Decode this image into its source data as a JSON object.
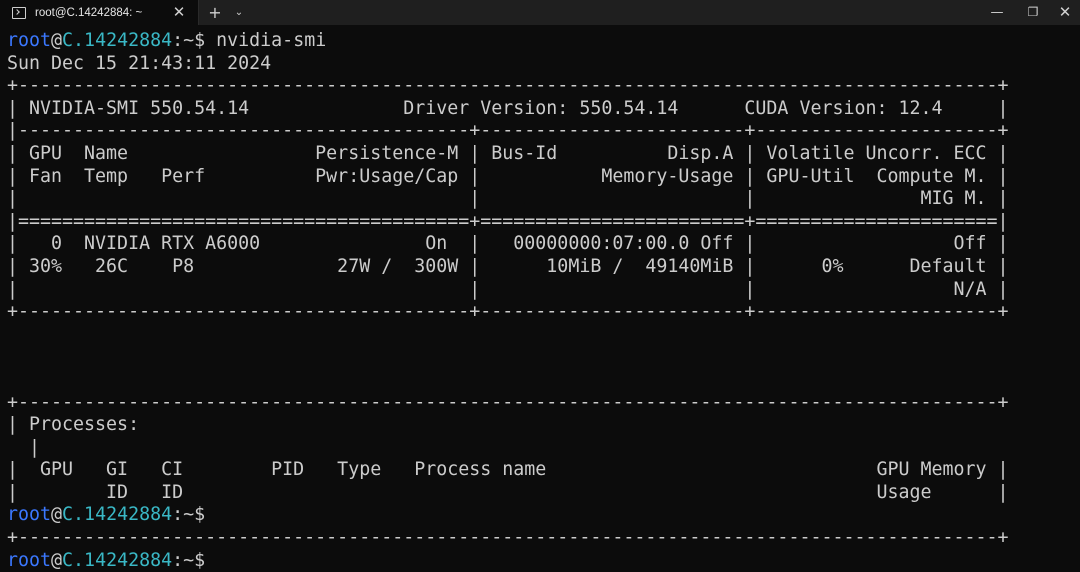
{
  "titlebar": {
    "tab_title": "root@C.14242884: ~",
    "tab_close": "✕",
    "new_tab": "+",
    "dropdown": "⌄",
    "minimize": "—",
    "maximize": "❐",
    "close": "✕"
  },
  "prompt": {
    "user": "root",
    "at": "@",
    "host": "C.14242884",
    "path": ":~$"
  },
  "terminal": {
    "command": " nvidia-smi",
    "output1": "Sun Dec 15 21:43:11 2024\n+-----------------------------------------------------------------------------------------+\n| NVIDIA-SMI 550.54.14              Driver Version: 550.54.14      CUDA Version: 12.4     |\n|-----------------------------------------+------------------------+----------------------+\n| GPU  Name                 Persistence-M | Bus-Id          Disp.A | Volatile Uncorr. ECC |\n| Fan  Temp   Perf          Pwr:Usage/Cap |           Memory-Usage | GPU-Util  Compute M. |\n|                                         |                        |               MIG M. |\n|=========================================+========================+======================|\n|   0  NVIDIA RTX A6000               On  |   00000000:07:00.0 Off |                  Off |\n| 30%   26C    P8             27W /  300W |      10MiB /  49140MiB |      0%      Default |\n|                                         |                        |                  N/A |\n+-----------------------------------------+------------------------+----------------------+\n\n\n\n+-----------------------------------------------------------------------------------------+\n| Processes:\n  |\n|  GPU   GI   CI        PID   Type   Process name                              GPU Memory |\n|        ID   ID                                                               Usage      |",
    "output2": "+-----------------------------------------------------------------------------------------+"
  }
}
